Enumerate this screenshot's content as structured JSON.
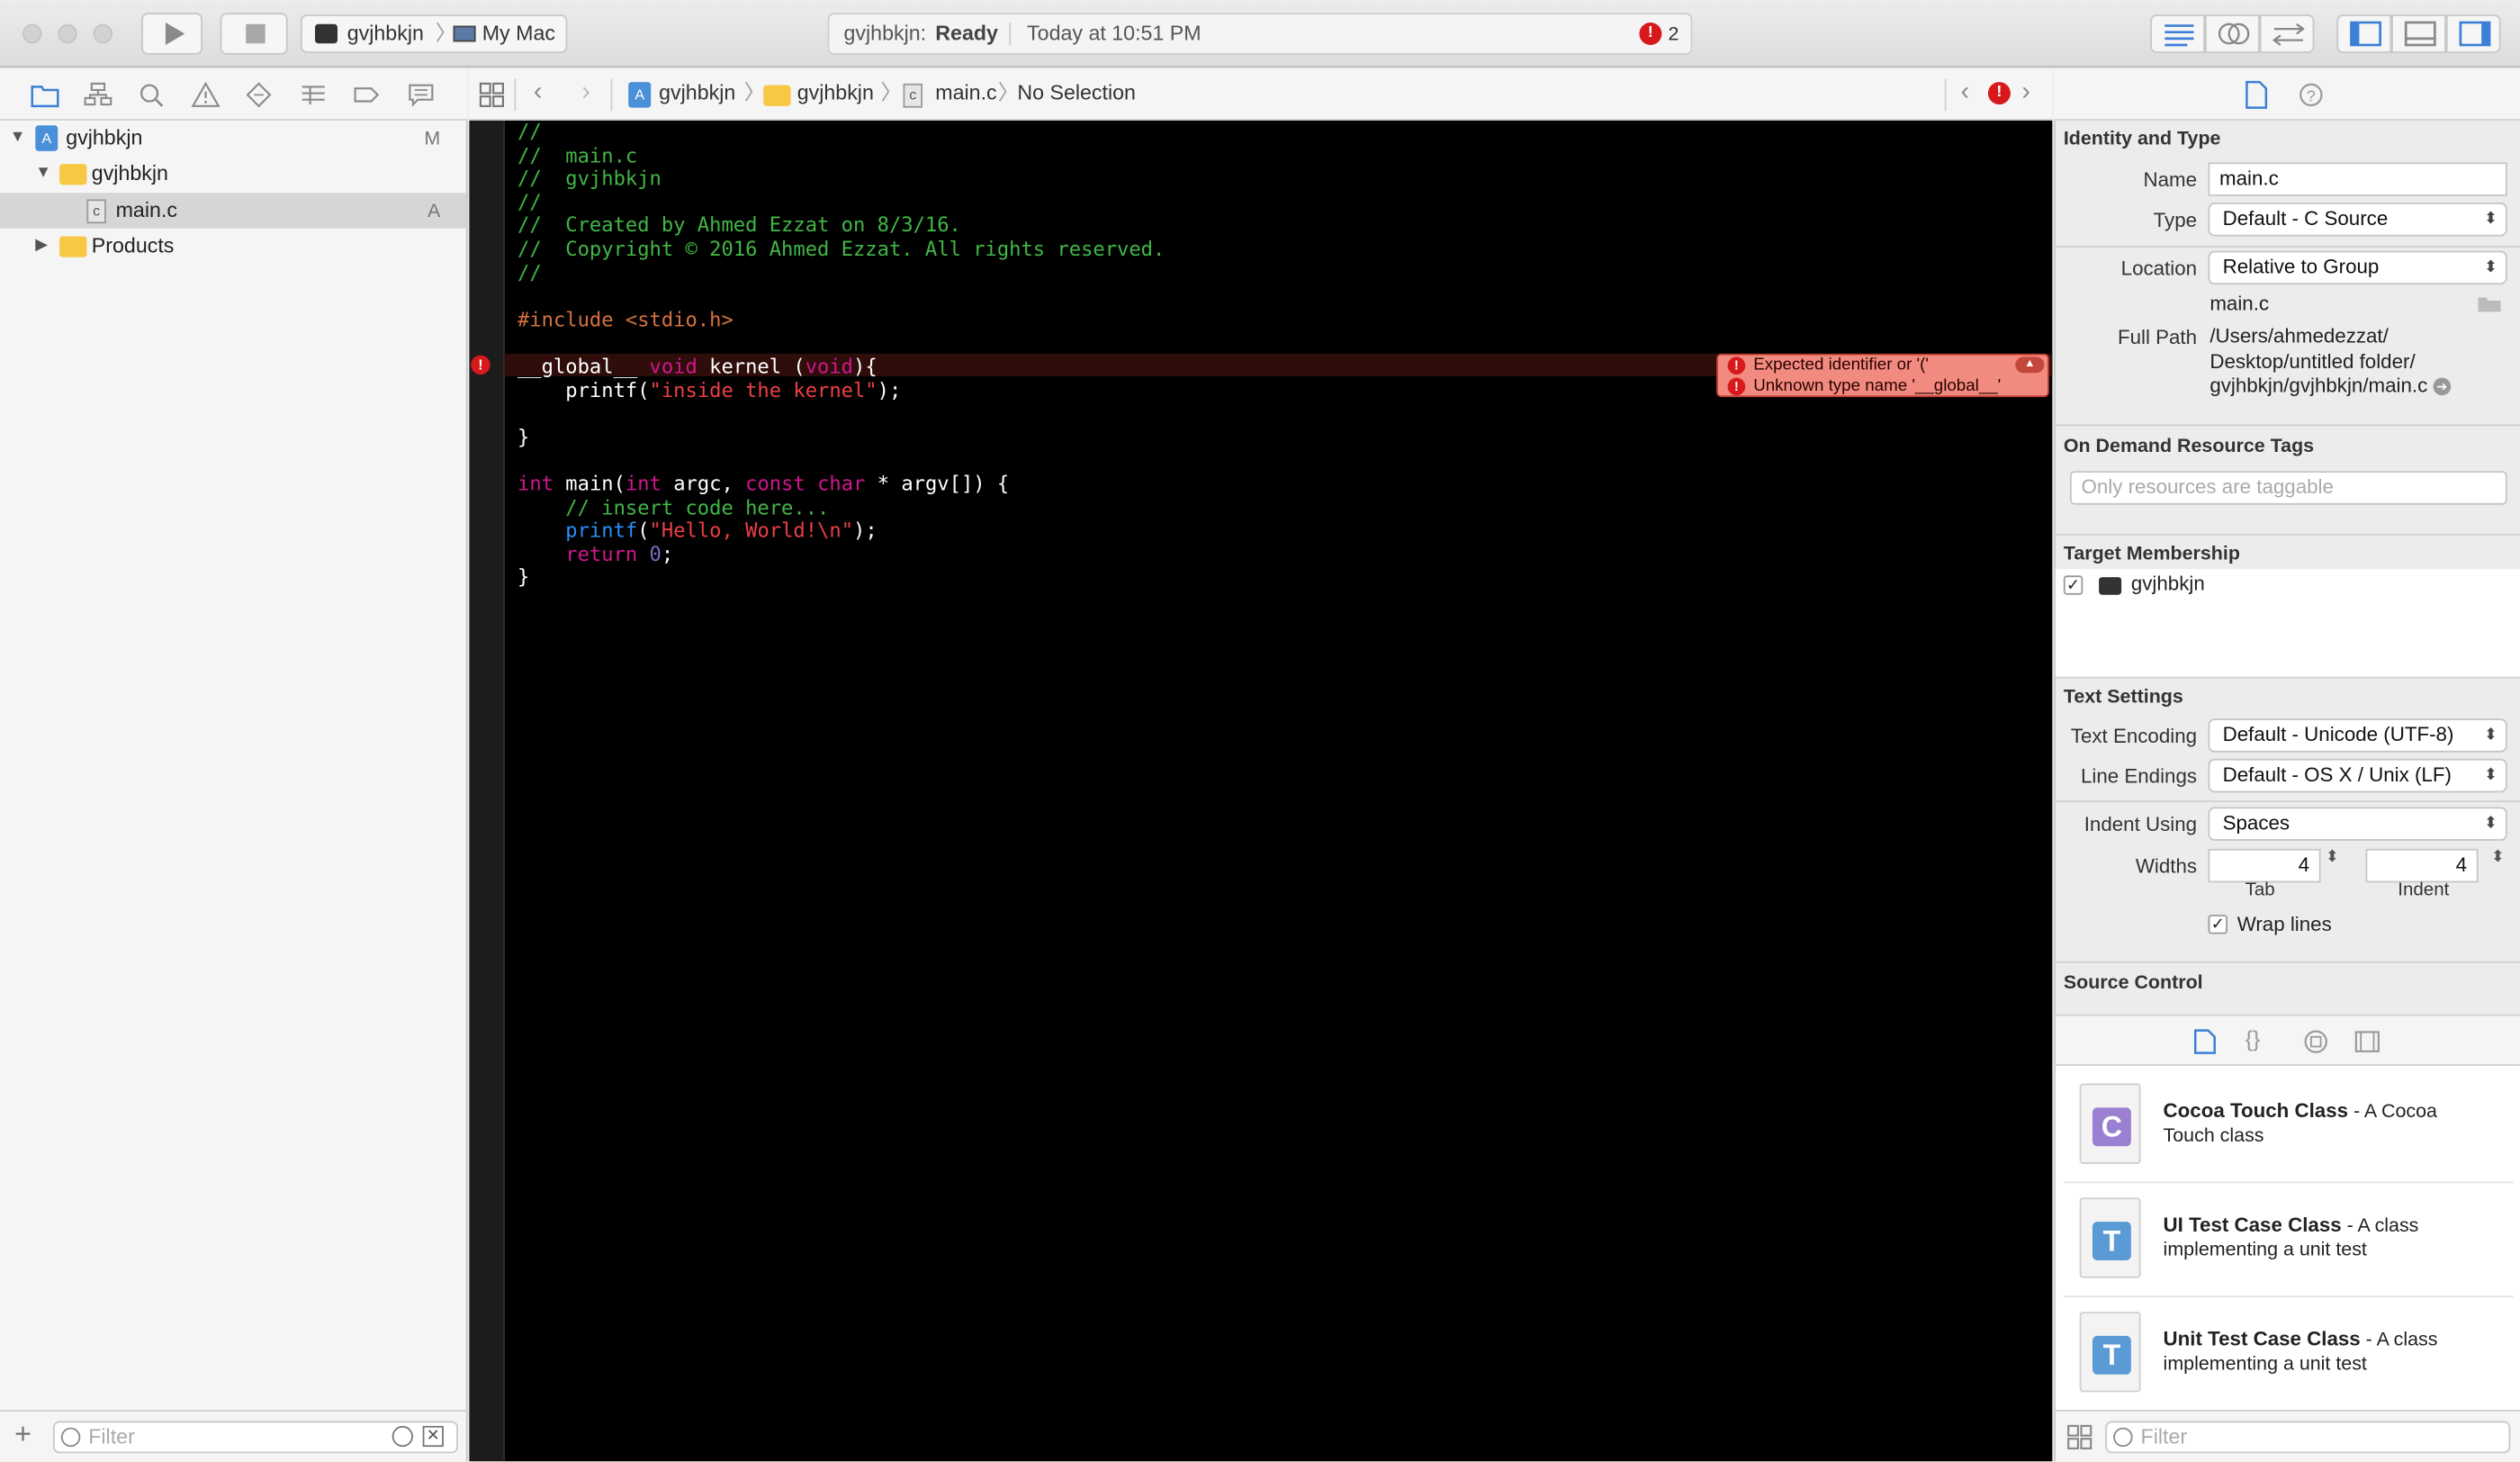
{
  "toolbar": {
    "scheme_name": "gvjhbkjn",
    "destination": "My Mac",
    "status_project": "gvjhbkjn:",
    "status_state": "Ready",
    "status_time": "Today at 10:51 PM",
    "error_count": "2"
  },
  "navigator": {
    "items": [
      {
        "label": "gvjhbkjn",
        "scm": "M"
      },
      {
        "label": "gvjhbkjn",
        "scm": ""
      },
      {
        "label": "main.c",
        "scm": "A"
      },
      {
        "label": "Products",
        "scm": ""
      }
    ],
    "filter_placeholder": "Filter"
  },
  "jumpbar": {
    "crumbs": [
      "gvjhbkjn",
      "gvjhbkjn",
      "main.c",
      "No Selection"
    ]
  },
  "editor": {
    "lines": [
      "//",
      "//  main.c",
      "//  gvjhbkjn",
      "//",
      "//  Created by Ahmed Ezzat on 8/3/16.",
      "//  Copyright © 2016 Ahmed Ezzat. All rights reserved.",
      "//",
      "",
      "#include <stdio.h>",
      "",
      "__global__ void kernel (void){",
      "    printf(\"inside the kernel\");",
      "",
      "}",
      "",
      "int main(int argc, const char * argv[]) {",
      "    // insert code here...",
      "    printf(\"Hello, World!\\n\");",
      "    return 0;",
      "}"
    ],
    "errors": [
      "Expected identifier or '('",
      "Unknown type name '__global__'"
    ]
  },
  "inspector": {
    "identity_header": "Identity and Type",
    "name_label": "Name",
    "name_value": "main.c",
    "type_label": "Type",
    "type_value": "Default - C Source",
    "location_label": "Location",
    "location_value": "Relative to Group",
    "location_file": "main.c",
    "fullpath_label": "Full Path",
    "fullpath_lines": [
      "/Users/ahmedezzat/",
      "Desktop/untitled folder/",
      "gvjhbkjn/gvjhbkjn/main.c"
    ],
    "odr_header": "On Demand Resource Tags",
    "odr_placeholder": "Only resources are taggable",
    "target_header": "Target Membership",
    "target_name": "gvjhbkjn",
    "text_header": "Text Settings",
    "encoding_label": "Text Encoding",
    "encoding_value": "Default - Unicode (UTF-8)",
    "endings_label": "Line Endings",
    "endings_value": "Default - OS X / Unix (LF)",
    "indent_label": "Indent Using",
    "indent_value": "Spaces",
    "widths_label": "Widths",
    "tab_value": "4",
    "indent_width_value": "4",
    "tab_caption": "Tab",
    "indent_caption": "Indent",
    "wrap_label": "Wrap lines",
    "source_control_header": "Source Control"
  },
  "library": {
    "items": [
      {
        "title": "Cocoa Touch Class",
        "desc_1": " - A Cocoa",
        "desc_2": "Touch class",
        "letter": "C",
        "color": "#9b7fd1"
      },
      {
        "title": "UI Test Case Class",
        "desc_1": " - A class",
        "desc_2": "implementing a unit test",
        "letter": "T",
        "color": "#5b9bd5"
      },
      {
        "title": "Unit Test Case Class",
        "desc_1": " - A class",
        "desc_2": "implementing a unit test",
        "letter": "T",
        "color": "#5b9bd5"
      }
    ],
    "filter_placeholder": "Filter"
  },
  "colors": {
    "error": "#d7191c",
    "editor_bg": "#000000",
    "comment": "#41b645",
    "keyword": "#d0168d",
    "string": "#ec3f44"
  }
}
